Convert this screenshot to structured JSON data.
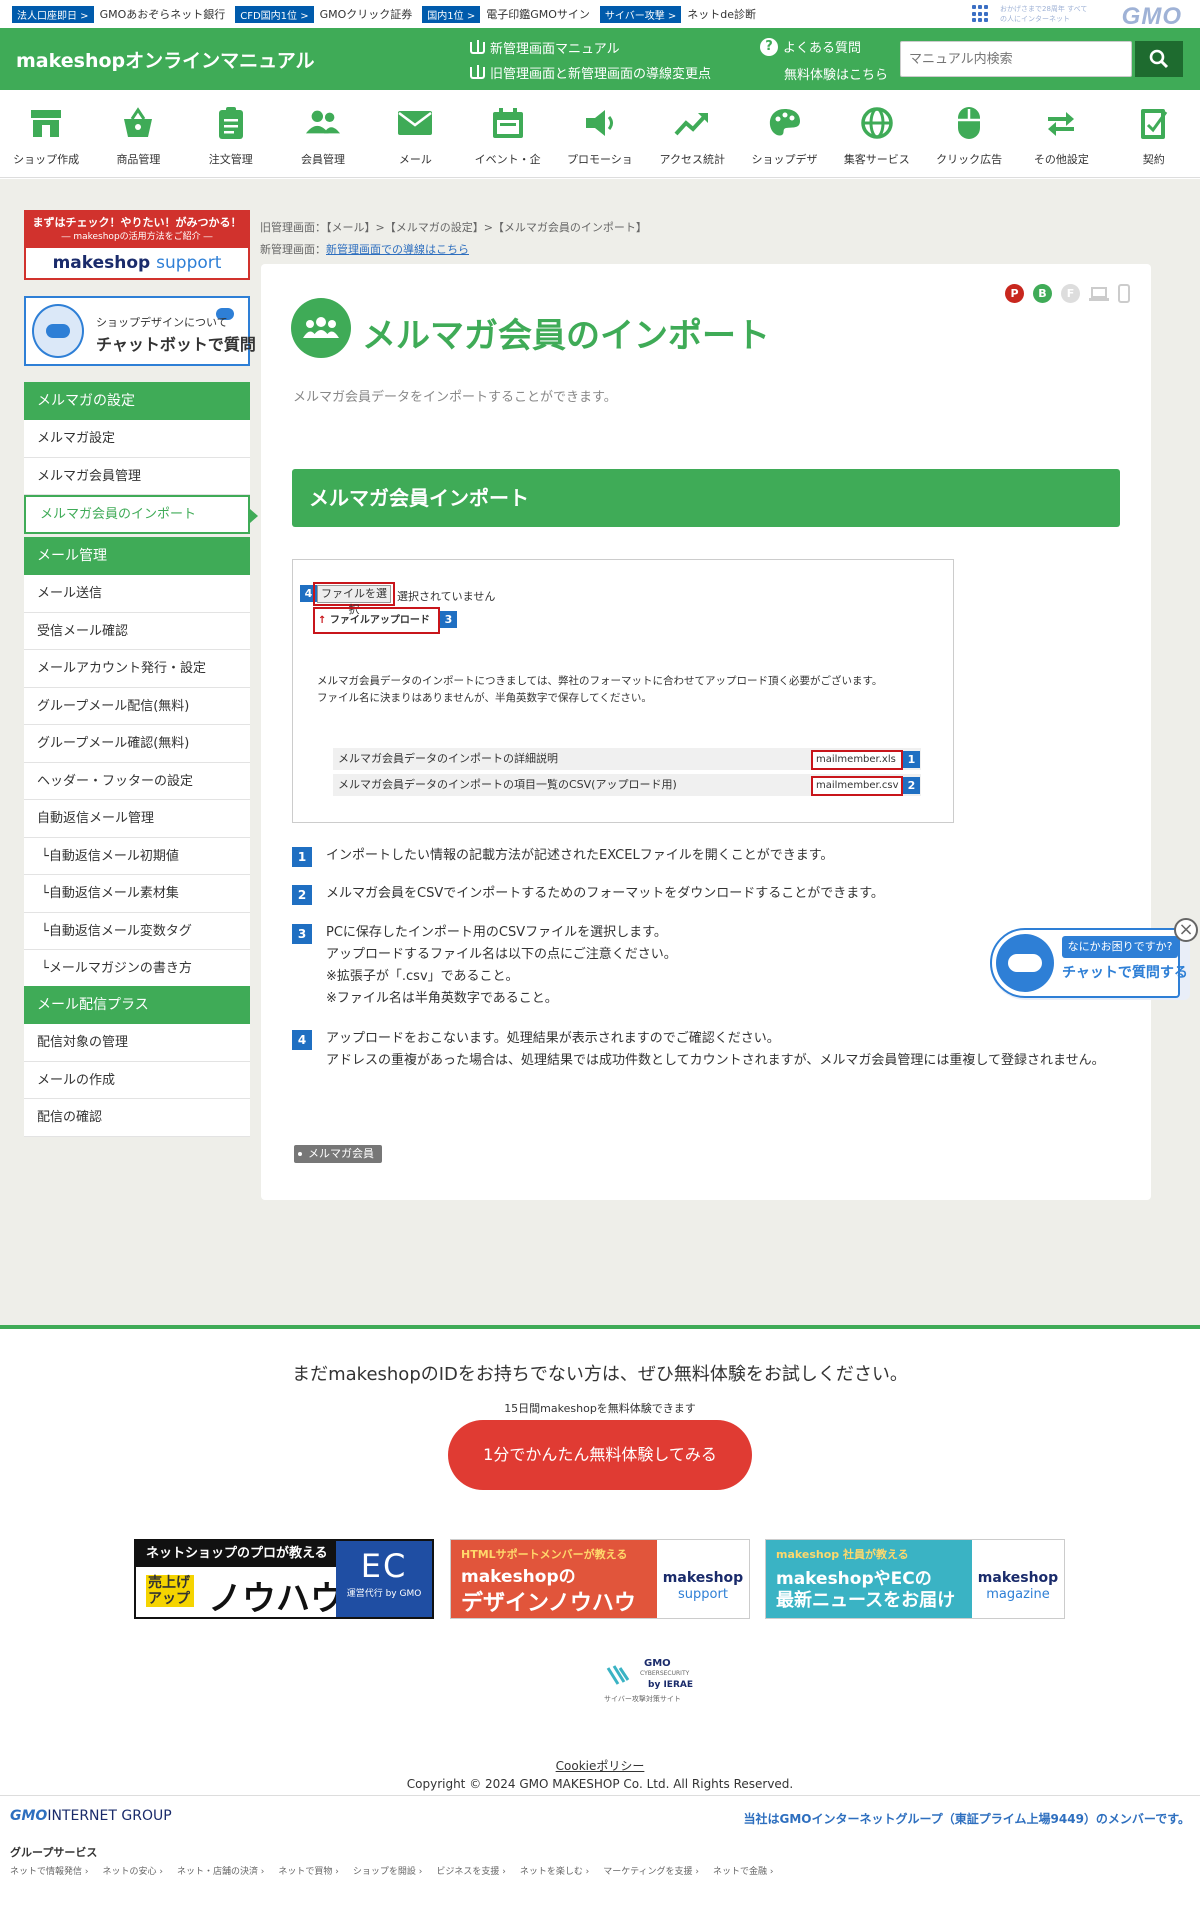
{
  "topbar": {
    "items": [
      {
        "badge": "法人口座即日 >",
        "text": "GMOあおぞらネット銀行"
      },
      {
        "badge": "CFD国内1位 >",
        "text": "GMOクリック証券"
      },
      {
        "badge": "国内1位 >",
        "text": "電子印鑑GMOサイン"
      },
      {
        "badge": "サイバー攻撃 >",
        "text": "ネットde診断"
      }
    ],
    "gmo_tagline": "おかげさまで28周年 すべての人にインターネット",
    "gmo_logo": "GMO"
  },
  "header": {
    "title": "makeshopオンラインマニュアル",
    "link_new_manual": "新管理画面マニュアル",
    "link_migration": "旧管理画面と新管理画面の導線変更点",
    "link_faq": "よくある質問",
    "link_trial": "無料体験はこちら",
    "search_placeholder": "マニュアル内検索"
  },
  "nav": [
    {
      "label": "ショップ作成",
      "icon": "shop-icon"
    },
    {
      "label": "商品管理",
      "icon": "basket-icon"
    },
    {
      "label": "注文管理",
      "icon": "clipboard-icon"
    },
    {
      "label": "会員管理",
      "icon": "members-icon"
    },
    {
      "label": "メール",
      "icon": "mail-icon"
    },
    {
      "label": "イベント・企",
      "icon": "calendar-icon"
    },
    {
      "label": "プロモーショ",
      "icon": "megaphone-icon"
    },
    {
      "label": "アクセス統計",
      "icon": "trend-chart-icon"
    },
    {
      "label": "ショップデザ",
      "icon": "palette-icon"
    },
    {
      "label": "集客サービス",
      "icon": "globe-icon"
    },
    {
      "label": "クリック広告",
      "icon": "mouse-icon"
    },
    {
      "label": "その他設定",
      "icon": "arrows-icon"
    },
    {
      "label": "契約",
      "icon": "contract-icon"
    }
  ],
  "sidebar": {
    "banner1": {
      "top": "まずはチェック！やりたい！がみつかる！",
      "sub": "― makeshopの活用方法をご紹介 ―",
      "logo": "makeshop",
      "logo2": "support"
    },
    "banner2": {
      "line1": "ショップデザインについて",
      "line2": "チャットボットで質問"
    },
    "groups": [
      {
        "head": "メルマガの設定",
        "items": [
          {
            "label": "メルマガ設定",
            "active": false,
            "sub": false
          },
          {
            "label": "メルマガ会員管理",
            "active": false,
            "sub": false
          },
          {
            "label": "メルマガ会員のインポート",
            "active": true,
            "sub": false
          }
        ]
      },
      {
        "head": "メール管理",
        "items": [
          {
            "label": "メール送信",
            "active": false,
            "sub": false
          },
          {
            "label": "受信メール確認",
            "active": false,
            "sub": false
          },
          {
            "label": "メールアカウント発行・設定",
            "active": false,
            "sub": false
          },
          {
            "label": "グループメール配信(無料)",
            "active": false,
            "sub": false
          },
          {
            "label": "グループメール確認(無料)",
            "active": false,
            "sub": false
          },
          {
            "label": "ヘッダー・フッターの設定",
            "active": false,
            "sub": false
          },
          {
            "label": "自動返信メール管理",
            "active": false,
            "sub": false
          },
          {
            "label": "└自動返信メール初期値",
            "active": false,
            "sub": true
          },
          {
            "label": "└自動返信メール素材集",
            "active": false,
            "sub": true
          },
          {
            "label": "└自動返信メール変数タグ",
            "active": false,
            "sub": true
          },
          {
            "label": "└メールマガジンの書き方",
            "active": false,
            "sub": true
          }
        ]
      },
      {
        "head": "メール配信プラス",
        "items": [
          {
            "label": "配信対象の管理",
            "active": false,
            "sub": false
          },
          {
            "label": "メールの作成",
            "active": false,
            "sub": false
          },
          {
            "label": "配信の確認",
            "active": false,
            "sub": false
          }
        ]
      }
    ]
  },
  "breadcrumb": {
    "old_label": "旧管理画面：",
    "old_path": "【メール】>【メルマガの設定】>【メルマガ会員のインポート】",
    "new_label": "新管理画面：",
    "new_link": "新管理画面での導線はこちら"
  },
  "main": {
    "title": "メルマガ会員のインポート",
    "devices": [
      "P",
      "B",
      "F"
    ],
    "intro": "メルマガ会員データをインポートすることができます。",
    "section_title": "メルマガ会員インポート",
    "screenshot": {
      "file_button": "ファイルを選択",
      "no_file": "選択されていません",
      "upload_button": "ファイルアップロード",
      "note1": "メルマガ会員データのインポートにつきましては、弊社のフォーマットに合わせてアップロード頂く必要がございます。",
      "note2": "ファイル名に決まりはありませんが、半角英数字で保存してください。",
      "row1_label": "メルマガ会員データのインポートの詳細説明",
      "row1_link": "mailmember.xls",
      "row2_label": "メルマガ会員データのインポートの項目一覧のCSV(アップロード用)",
      "row2_link": "mailmember.csv",
      "n1": "1",
      "n2": "2",
      "n3": "3",
      "n4": "4"
    },
    "steps": [
      {
        "num": "1",
        "text": "インポートしたい情報の記載方法が記述されたEXCELファイルを開くことができます。"
      },
      {
        "num": "2",
        "text": "メルマガ会員をCSVでインポートするためのフォーマットをダウンロードすることができます。"
      },
      {
        "num": "3",
        "text": "PCに保存したインポート用のCSVファイルを選択します。\nアップロードするファイル名は以下の点にご注意ください。\n※拡張子が「.csv」であること。\n※ファイル名は半角英数字であること。"
      },
      {
        "num": "4",
        "text": "アップロードをおこないます。処理結果が表示されますのでご確認ください。\nアドレスの重複があった場合は、処理結果では成功件数としてカウントされますが、メルマガ会員管理には重複して登録されません。"
      }
    ],
    "tag": "メルマガ会員"
  },
  "chat": {
    "question": "なにかお困りですか?",
    "action": "チャットで質問する",
    "close": "×"
  },
  "footer": {
    "cta_text": "まだmakeshopのIDをお持ちでない方は、ぜひ無料体験をお試しください。",
    "cta_sub": "15日間makeshopを無料体験できます",
    "cta_button": "1分でかんたん無料体験してみる",
    "banner1": {
      "head": "ネットショップのプロが教える",
      "badge": "売上げアップ",
      "main": "ノウハウ",
      "right": "EC",
      "right_sub": "運営代行 by GMO"
    },
    "banner2": {
      "sup": "HTMLサポートメンバーが教える",
      "main": "makeshopの",
      "big": "デザインノウハウ",
      "logo": "makeshop",
      "logo2": "support"
    },
    "banner3": {
      "sup": "makeshop 社員が教える",
      "main": "makeshopやECの",
      "big": "最新ニュースをお届け",
      "logo": "makeshop",
      "logo2": "magazine"
    },
    "cyber": {
      "t1": "GMO",
      "t2": "CYBERSECURITY",
      "t3": "by IERAE",
      "t4": "サイバー攻撃対策サイト"
    },
    "cookie": "Cookieポリシー",
    "copyright": "Copyright © 2024 GMO MAKESHOP Co. Ltd. All Rights Reserved.",
    "gmo_group": "INTERNET GROUP",
    "gmo_group_logo": "GMO",
    "member_text": "当社はGMOインターネットグループ（東証プライム上場9449）のメンバーです。",
    "group_head": "グループサービス",
    "group_links": [
      "ネットで情報発信 ›",
      "ネットの安心 ›",
      "ネット・店舗の決済 ›",
      "ネットで買物 ›",
      "ショップを開設 ›",
      "ビジネスを支援 ›",
      "ネットを楽しむ ›",
      "マーケティングを支援 ›",
      "ネットで金融 ›"
    ]
  },
  "colors": {
    "brand_green": "#3fab57",
    "accent_red": "#e03b33",
    "step_blue": "#1f6fc2"
  }
}
